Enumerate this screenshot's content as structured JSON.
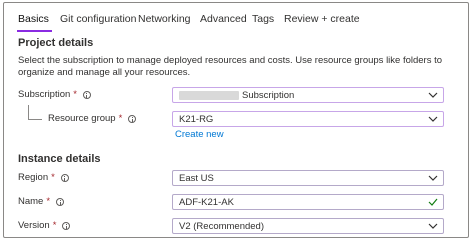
{
  "tabs": [
    {
      "label": "Basics",
      "active": true
    },
    {
      "label": "Git configuration"
    },
    {
      "label": "Networking"
    },
    {
      "label": "Advanced"
    },
    {
      "label": "Tags"
    },
    {
      "label": "Review + create"
    }
  ],
  "project": {
    "title": "Project details",
    "description": "Select the subscription to manage deployed resources and costs. Use resource groups like folders to organize and manage all your resources.",
    "subscription": {
      "label": "Subscription",
      "required": "*",
      "value": "Subscription"
    },
    "resource_group": {
      "label": "Resource group",
      "required": "*",
      "value": "K21-RG",
      "create_new": "Create new"
    }
  },
  "instance": {
    "title": "Instance details",
    "region": {
      "label": "Region",
      "required": "*",
      "value": "East US"
    },
    "name": {
      "label": "Name",
      "required": "*",
      "value": "ADF-K21-AK"
    },
    "version": {
      "label": "Version",
      "required": "*",
      "value": "V2 (Recommended)"
    }
  },
  "colors": {
    "accent": "#8a2be2",
    "link": "#0078d4",
    "required": "#a4262c",
    "valid": "#107c10"
  }
}
